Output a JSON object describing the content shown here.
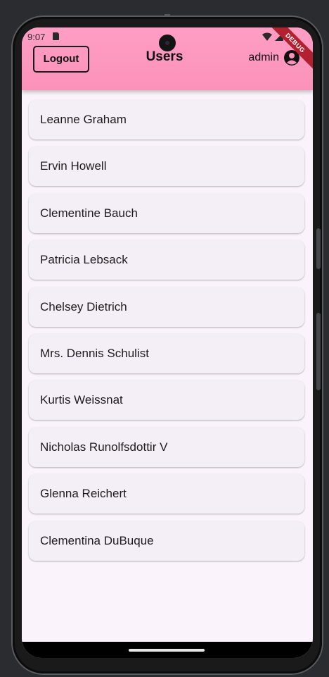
{
  "status_bar": {
    "time": "9:07",
    "sd_card_icon": "sd-card-icon",
    "wifi_icon": "wifi-icon",
    "signal_icon": "signal-icon",
    "battery_icon": "battery-icon"
  },
  "debug_banner": "DEBUG",
  "appbar": {
    "logout_label": "Logout",
    "title": "Users",
    "username": "admin",
    "avatar_icon": "account-circle-icon",
    "background": "#fb92b9"
  },
  "users": [
    "Leanne Graham",
    "Ervin Howell",
    "Clementine Bauch",
    "Patricia Lebsack",
    "Chelsey Dietrich",
    "Mrs. Dennis Schulist",
    "Kurtis Weissnat",
    "Nicholas Runolfsdottir V",
    "Glenna Reichert",
    "Clementina DuBuque"
  ]
}
